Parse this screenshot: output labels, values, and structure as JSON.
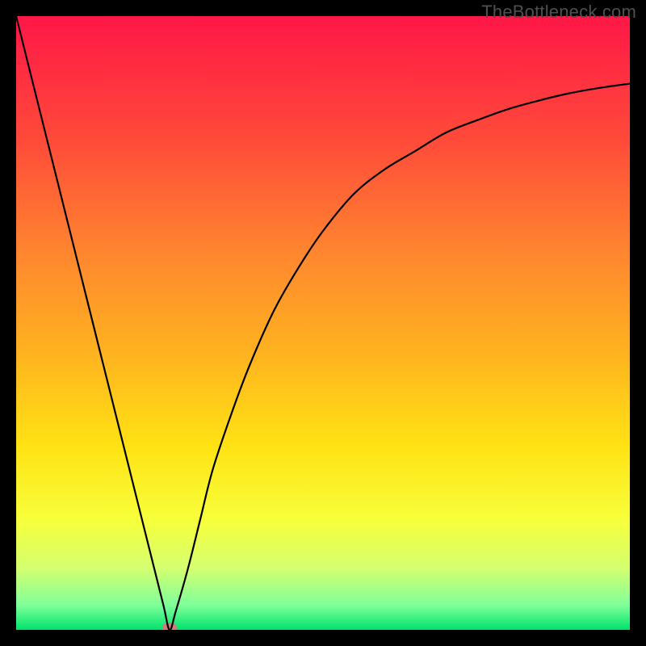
{
  "watermark": "TheBottleneck.com",
  "chart_data": {
    "type": "line",
    "title": "",
    "xlabel": "",
    "ylabel": "",
    "xlim": [
      0,
      100
    ],
    "ylim": [
      0,
      100
    ],
    "grid": false,
    "legend": false,
    "background": {
      "type": "vertical-gradient",
      "stops": [
        {
          "pos": 0.0,
          "color": "#ff1747"
        },
        {
          "pos": 0.2,
          "color": "#ff4a3a"
        },
        {
          "pos": 0.4,
          "color": "#ff8a2e"
        },
        {
          "pos": 0.55,
          "color": "#ffb31f"
        },
        {
          "pos": 0.7,
          "color": "#ffe214"
        },
        {
          "pos": 0.82,
          "color": "#f7ff3a"
        },
        {
          "pos": 0.9,
          "color": "#d4ff70"
        },
        {
          "pos": 0.96,
          "color": "#7fff9a"
        },
        {
          "pos": 1.0,
          "color": "#00e36c"
        }
      ]
    },
    "series": [
      {
        "name": "bottleneck-curve",
        "color": "#000000",
        "x": [
          0,
          2,
          4,
          6,
          8,
          10,
          12,
          14,
          16,
          18,
          20,
          22,
          24,
          25,
          26,
          28,
          30,
          32,
          35,
          38,
          42,
          46,
          50,
          55,
          60,
          65,
          70,
          75,
          80,
          85,
          90,
          95,
          100
        ],
        "y": [
          100,
          92,
          84,
          76,
          68,
          60,
          52,
          44,
          36,
          28,
          20,
          12,
          4,
          0,
          3,
          10,
          18,
          26,
          35,
          43,
          52,
          59,
          65,
          71,
          75,
          78,
          81,
          83,
          84.8,
          86.2,
          87.4,
          88.3,
          89
        ]
      }
    ],
    "markers": [
      {
        "name": "min-point-dot",
        "x": 25,
        "y": 0,
        "color": "#d47a7a",
        "rx": 9,
        "ry": 6
      }
    ]
  }
}
